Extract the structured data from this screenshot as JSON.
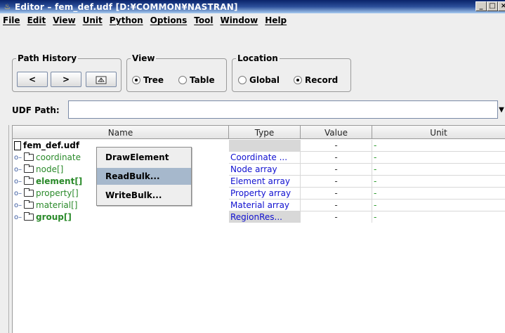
{
  "window": {
    "title": "Editor – fem_def.udf [D:¥COMMON¥NASTRAN]",
    "controls": [
      "_",
      "□",
      "×"
    ]
  },
  "menubar": [
    "File",
    "Edit",
    "View",
    "Unit",
    "Python",
    "Options",
    "Tool",
    "Window",
    "Help"
  ],
  "path_history": {
    "legend": "Path History",
    "back": "<",
    "forward": ">",
    "icon": "folder-up-icon"
  },
  "view": {
    "legend": "View",
    "options": [
      "Tree",
      "Table"
    ],
    "selected": "Tree"
  },
  "location": {
    "legend": "Location",
    "options": [
      "Global",
      "Record"
    ],
    "selected": "Record"
  },
  "udf_path": {
    "label": "UDF Path:",
    "value": ""
  },
  "table": {
    "columns": [
      "Name",
      "Type",
      "Value",
      "Unit"
    ],
    "root": {
      "name": "fem_def.udf",
      "value": "-",
      "unit": "-"
    },
    "rows": [
      {
        "name": "coordinate",
        "type": "Coordinate ...",
        "value": "-",
        "unit": "-"
      },
      {
        "name": "node[]",
        "type": "Node array",
        "value": "-",
        "unit": "-"
      },
      {
        "name": "element[]",
        "type": "Element array",
        "value": "-",
        "unit": "-"
      },
      {
        "name": "property[]",
        "type": "Property array",
        "value": "-",
        "unit": "-"
      },
      {
        "name": "material[]",
        "type": "Material array",
        "value": "-",
        "unit": "-"
      },
      {
        "name": "group[]",
        "type": "RegionRes...",
        "value": "-",
        "unit": "-"
      }
    ]
  },
  "context_menu": {
    "items": [
      "DrawElement",
      "ReadBulk...",
      "WriteBulk..."
    ],
    "highlighted": "ReadBulk..."
  },
  "colors": {
    "title_bar": "#0a246a",
    "highlight": "#a6b8cc",
    "type_text": "#1010d0",
    "unit_text": "#2a9a2a"
  }
}
